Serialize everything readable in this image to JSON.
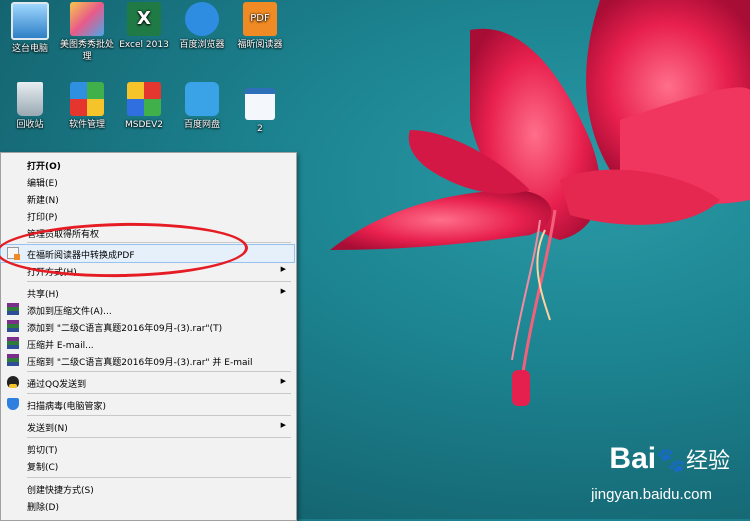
{
  "desktop_icons": [
    {
      "label": "这台电脑",
      "icon": "computer-icon"
    },
    {
      "label": "美图秀秀批处理",
      "icon": "meitu-icon"
    },
    {
      "label": "Excel 2013",
      "icon": "excel-icon"
    },
    {
      "label": "百度浏览器",
      "icon": "baidu-browser-icon"
    },
    {
      "label": "福昕阅读器",
      "icon": "foxit-reader-icon"
    },
    {
      "label": "回收站",
      "icon": "recycle-bin-icon"
    },
    {
      "label": "软件管理",
      "icon": "software-manager-icon"
    },
    {
      "label": "MSDEV2",
      "icon": "msdev-icon"
    },
    {
      "label": "百度网盘",
      "icon": "baidu-netdisk-icon"
    },
    {
      "label": "2",
      "icon": "document-icon"
    }
  ],
  "menu": {
    "open": "打开(O)",
    "edit": "编辑(E)",
    "new": "新建(N)",
    "print": "打印(P)",
    "take_ownership": "管理员取得所有权",
    "foxit_convert": "在福昕阅读器中转换成PDF",
    "open_with": "打开方式(H)",
    "share": "共享(H)",
    "add_archive": "添加到压缩文件(A)...",
    "add_to_rar": "添加到 \"二级C语言真题2016年09月-(3).rar\"(T)",
    "compress_email": "压缩并 E-mail...",
    "compress_rar_email": "压缩到 \"二级C语言真题2016年09月-(3).rar\" 并 E-mail",
    "send_qq": "通过QQ发送到",
    "scan_virus": "扫描病毒(电脑管家)",
    "send_to": "发送到(N)",
    "cut": "剪切(T)",
    "copy": "复制(C)",
    "create_shortcut": "创建快捷方式(S)",
    "delete": "删除(D)"
  },
  "watermark": {
    "brand": "Bai",
    "brand2": "经验",
    "url": "jingyan.baidu.com"
  }
}
